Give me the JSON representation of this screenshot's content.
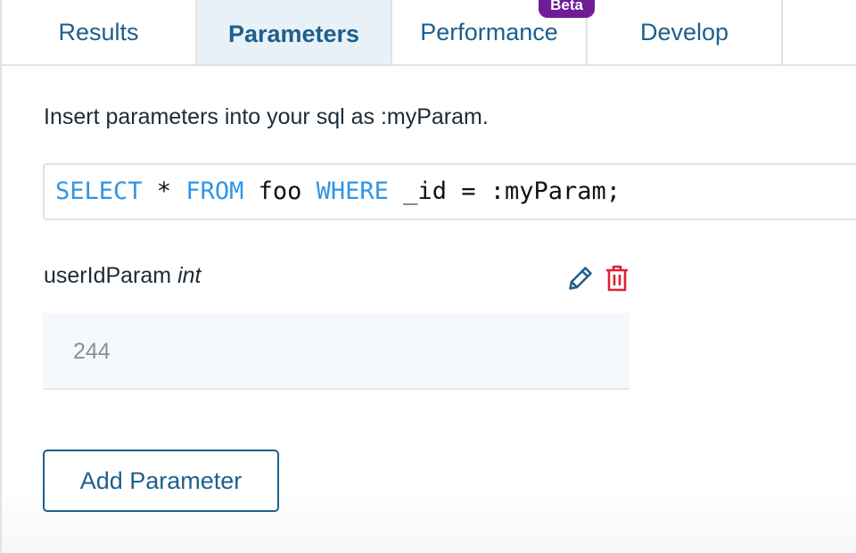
{
  "tabs": [
    {
      "label": "Results",
      "active": false
    },
    {
      "label": "Parameters",
      "active": true
    },
    {
      "label": "Performance",
      "active": false,
      "badge": "Beta"
    },
    {
      "label": "Develop",
      "active": false
    }
  ],
  "colors": {
    "accent": "#1e5f8c",
    "active_tab_bg": "#e9f1f8",
    "beta_badge": "#6f1c97",
    "sql_keyword": "#2f95e6",
    "delete": "#e0212f"
  },
  "parameters_panel": {
    "hint": "Insert parameters into your sql as :myParam.",
    "sql_example": {
      "tokens": [
        {
          "text": "SELECT",
          "kind": "keyword"
        },
        {
          "text": " * ",
          "kind": "plain"
        },
        {
          "text": "FROM",
          "kind": "keyword"
        },
        {
          "text": " foo ",
          "kind": "plain"
        },
        {
          "text": "WHERE",
          "kind": "keyword"
        },
        {
          "text": " _id = :myParam;",
          "kind": "plain"
        }
      ]
    },
    "params": [
      {
        "name": "userIdParam",
        "type": "int",
        "value": "244",
        "edit_icon": "pencil-icon",
        "delete_icon": "trash-icon"
      }
    ],
    "add_button_label": "Add Parameter"
  }
}
